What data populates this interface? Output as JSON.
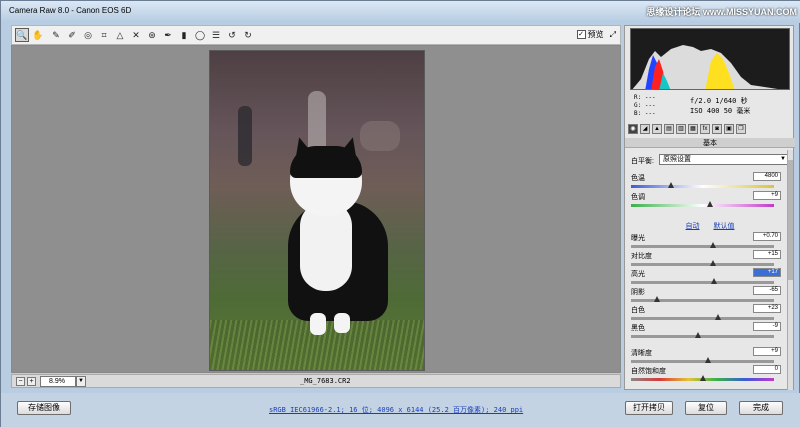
{
  "window": {
    "title": "Camera Raw 8.0 -  Canon EOS 6D",
    "watermark": "思缘设计论坛 www.MISSYUAN.COM"
  },
  "toolbar": {
    "tools": [
      "zoom-tool",
      "hand-tool",
      "white-balance-tool",
      "color-sampler-tool",
      "targeted-adjustment-tool",
      "crop-tool",
      "straighten-tool",
      "spot-removal-tool",
      "red-eye-tool",
      "adjustment-brush",
      "graduated-filter",
      "radial-filter",
      "preferences",
      "rotate-ccw",
      "rotate-cw"
    ],
    "preview_label": "预览",
    "preview_checked": true
  },
  "canvas": {
    "filename": "_MG_7683.CR2",
    "zoom": "8.9%"
  },
  "bottom": {
    "save_label": "存储图像",
    "workflow_link": "sRGB IEC61966-2.1; 16 位; 4096 x 6144 (25.2 百万像素); 240 ppi",
    "open_label": "打开拷贝",
    "reset_label": "复位",
    "done_label": "完成"
  },
  "panel": {
    "readout": {
      "r": "R:   ---",
      "g": "G:   ---",
      "b": "B:   ---"
    },
    "exif_line1": "f/2.0   1/640 秒",
    "exif_line2": "ISO 400   50 毫米",
    "section_title": "基本",
    "wb_label": "白平衡:",
    "wb_value": "原照设置",
    "auto_label": "自动",
    "default_label": "默认值",
    "sliders": [
      {
        "label": "色温",
        "value": "4800",
        "pos": 0.28
      },
      {
        "label": "色调",
        "value": "+9",
        "pos": 0.55
      },
      {
        "label": "曝光",
        "value": "+0.70",
        "pos": 0.57
      },
      {
        "label": "对比度",
        "value": "+15",
        "pos": 0.57
      },
      {
        "label": "高光",
        "value": "+17",
        "pos": 0.58
      },
      {
        "label": "阴影",
        "value": "-65",
        "pos": 0.18
      },
      {
        "label": "白色",
        "value": "+23",
        "pos": 0.61
      },
      {
        "label": "黑色",
        "value": "-9",
        "pos": 0.47
      },
      {
        "label": "清晰度",
        "value": "+9",
        "pos": 0.54
      },
      {
        "label": "自然饱和度",
        "value": "0",
        "pos": 0.5
      }
    ]
  }
}
